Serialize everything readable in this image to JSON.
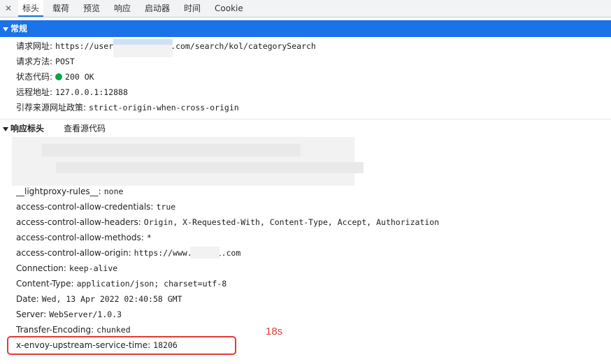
{
  "tabs": [
    {
      "label": "标头"
    },
    {
      "label": "载荷"
    },
    {
      "label": "预览"
    },
    {
      "label": "响应"
    },
    {
      "label": "启动器"
    },
    {
      "label": "时间"
    },
    {
      "label": "Cookie"
    }
  ],
  "active_tab": "标头",
  "general": {
    "title": "常规",
    "rows": [
      {
        "key": "请求网址:",
        "value": "https://user"
      },
      {
        "key": "请求方法:",
        "value": "POST"
      },
      {
        "key": "状态代码:",
        "value": "200 OK"
      },
      {
        "key": "远程地址:",
        "value": "127.0.0.1:12888"
      },
      {
        "key": "引荐来源网址政策:",
        "value": "strict-origin-when-cross-origin"
      }
    ],
    "url_suffix": ".com/search/kol/categorySearch"
  },
  "response_headers": {
    "title": "响应标头",
    "view_source": "查看源代码",
    "rows": [
      {
        "key": "__lightproxy-rules__:",
        "value": "none"
      },
      {
        "key": "access-control-allow-credentials:",
        "value": "true"
      },
      {
        "key": "access-control-allow-headers:",
        "value": "Origin, X-Requested-With, Content-Type, Accept, Authorization"
      },
      {
        "key": "access-control-allow-methods:",
        "value": "*"
      },
      {
        "key": "access-control-allow-origin:",
        "value": "https://www.:"
      },
      {
        "key": "Connection:",
        "value": "keep-alive"
      },
      {
        "key": "Content-Type:",
        "value": "application/json; charset=utf-8"
      },
      {
        "key": "Date:",
        "value": "Wed, 13 Apr 2022 02:40:58 GMT"
      },
      {
        "key": "Server:",
        "value": "WebServer/1.0.3"
      },
      {
        "key": "Transfer-Encoding:",
        "value": "chunked"
      },
      {
        "key": "x-envoy-upstream-service-time:",
        "value": "18206"
      }
    ],
    "origin_suffix": "i.com"
  },
  "annotation": "18s",
  "colors": {
    "accent": "#1a73e8",
    "status_ok": "#0aa34f",
    "annotation_red": "#e53935"
  }
}
